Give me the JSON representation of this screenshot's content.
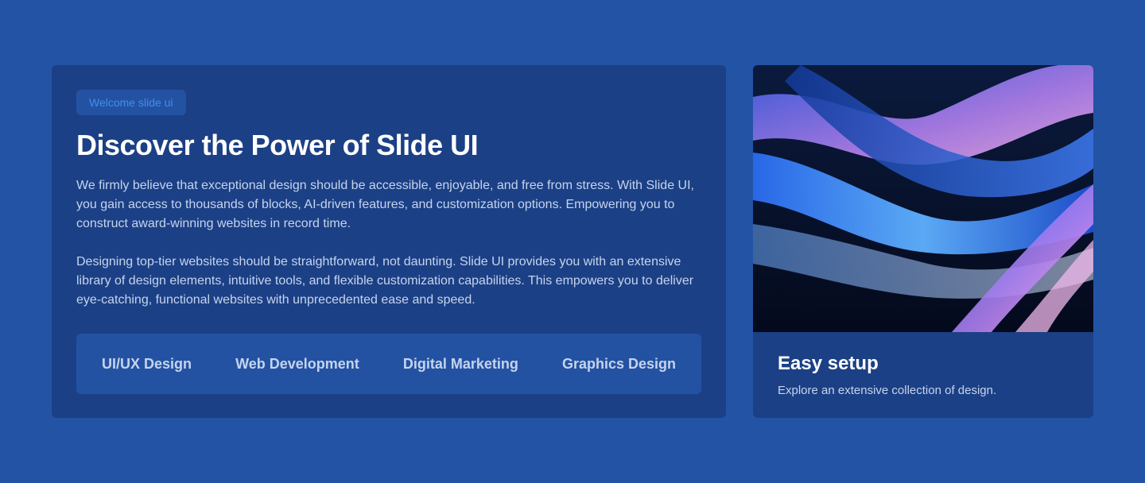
{
  "colors": {
    "page_background": "#2353a4",
    "card_background": "#1c4085",
    "badge_text": "#3f8ef0",
    "heading": "#ffffff",
    "body_text": "#c5d4ee"
  },
  "hero": {
    "badge": "Welcome slide ui",
    "title": "Discover the Power of Slide UI",
    "paragraphs": [
      "We firmly believe that exceptional design should be accessible, enjoyable, and free from stress. With Slide UI, you gain access to thousands of blocks, AI-driven features, and customization options. Empowering you to construct award-winning websites in record time.",
      "Designing top-tier websites should be straightforward, not daunting. Slide UI provides you with an extensive library of design elements, intuitive tools, and flexible customization capabilities. This empowers you to deliver eye-catching, functional websites with unprecedented ease and speed."
    ],
    "services": [
      "UI/UX Design",
      "Web Development",
      "Digital Marketing",
      "Graphics Design"
    ]
  },
  "feature": {
    "image": "abstract-blue-purple-waves",
    "title": "Easy setup",
    "description": "Explore an extensive collection of design."
  }
}
